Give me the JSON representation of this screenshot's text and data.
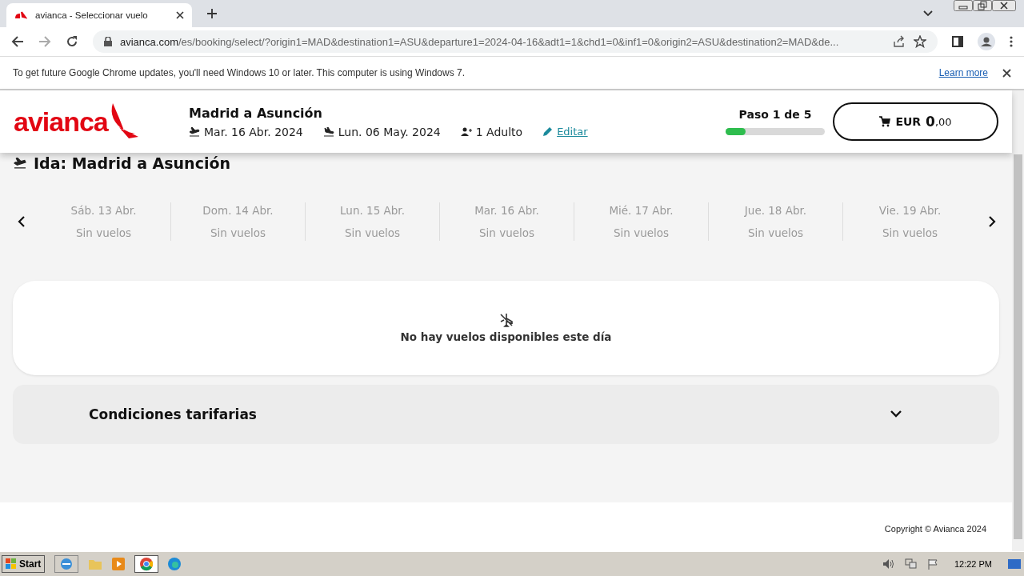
{
  "browser": {
    "tab_title": "avianca - Seleccionar vuelo",
    "url_host": "avianca.com",
    "url_path": "/es/booking/select/?origin1=MAD&destination1=ASU&departure1=2024-04-16&adt1=1&chd1=0&inf1=0&origin2=ASU&destination2=MAD&de...",
    "infobar": {
      "message": "To get future Google Chrome updates, you'll need Windows 10 or later. This computer is using Windows 7.",
      "link": "Learn more"
    }
  },
  "header": {
    "logo": "avianca",
    "route": "Madrid a Asunción",
    "departure": "Mar. 16 Abr. 2024",
    "return": "Lun. 06 May. 2024",
    "passengers": "1 Adulto",
    "edit": "Editar",
    "step": "Paso 1 de 5",
    "level": 0.2,
    "cart_currency": "EUR",
    "cart_amount": "0",
    "cart_decimals": ",00"
  },
  "section_title": "Ida: Madrid a Asunción",
  "dates": [
    {
      "day": "Sáb. 13 Abr.",
      "status": "Sin vuelos",
      "selected": false
    },
    {
      "day": "Dom. 14 Abr.",
      "status": "Sin vuelos",
      "selected": false
    },
    {
      "day": "Lun. 15 Abr.",
      "status": "Sin vuelos",
      "selected": false
    },
    {
      "day": "Mar. 16 Abr.",
      "status": "Sin vuelos",
      "selected": false
    },
    {
      "day": "Mié. 17 Abr.",
      "status": "Sin vuelos",
      "selected": false
    },
    {
      "day": "Jue. 18 Abr.",
      "status": "Sin vuelos",
      "selected": false
    },
    {
      "day": "Vie. 19 Abr.",
      "status": "Sin vuelos",
      "selected": false
    }
  ],
  "empty_message": "No hay vuelos disponibles este día",
  "conditions": {
    "title": "Condiciones tarifarias",
    "expanded": false
  },
  "footer": {
    "copyright": "Copyright © Avianca 2024"
  },
  "taskbar": {
    "start": "Start",
    "clock": "12:22 PM"
  }
}
